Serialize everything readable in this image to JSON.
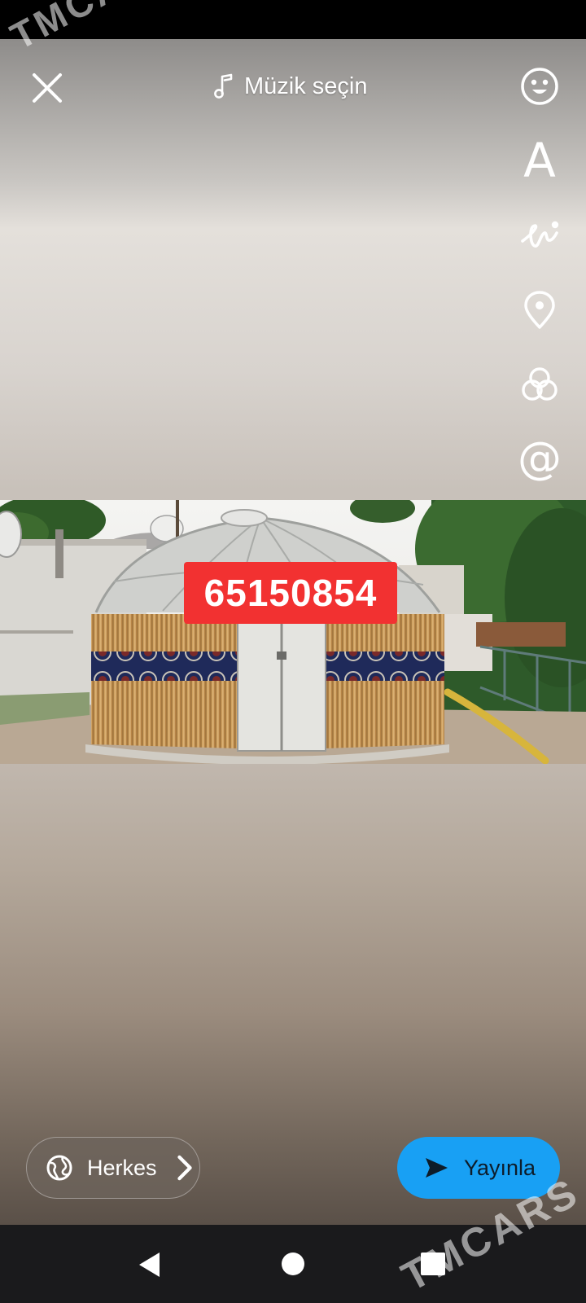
{
  "top_bar": {
    "close_icon": "close-icon",
    "music_label": "Müzik seçin",
    "music_icon": "music-note-icon"
  },
  "tools": [
    {
      "name": "sticker-icon"
    },
    {
      "name": "text-icon",
      "glyph": "A"
    },
    {
      "name": "draw-icon"
    },
    {
      "name": "location-icon"
    },
    {
      "name": "filter-icon"
    },
    {
      "name": "mention-icon",
      "glyph": "@"
    }
  ],
  "photo": {
    "phone_number": "65150854"
  },
  "bottom": {
    "audience_label": "Herkes",
    "audience_icon": "globe-icon",
    "publish_label": "Yayınla",
    "publish_icon": "send-icon"
  },
  "nav": {
    "back_icon": "back-icon",
    "home_icon": "home-icon",
    "recents_icon": "recents-icon"
  },
  "watermark": {
    "text": "TMCARS"
  },
  "colors": {
    "badge": "#f23131",
    "publish": "#18a0f4",
    "nav": "#1a1a1c"
  }
}
